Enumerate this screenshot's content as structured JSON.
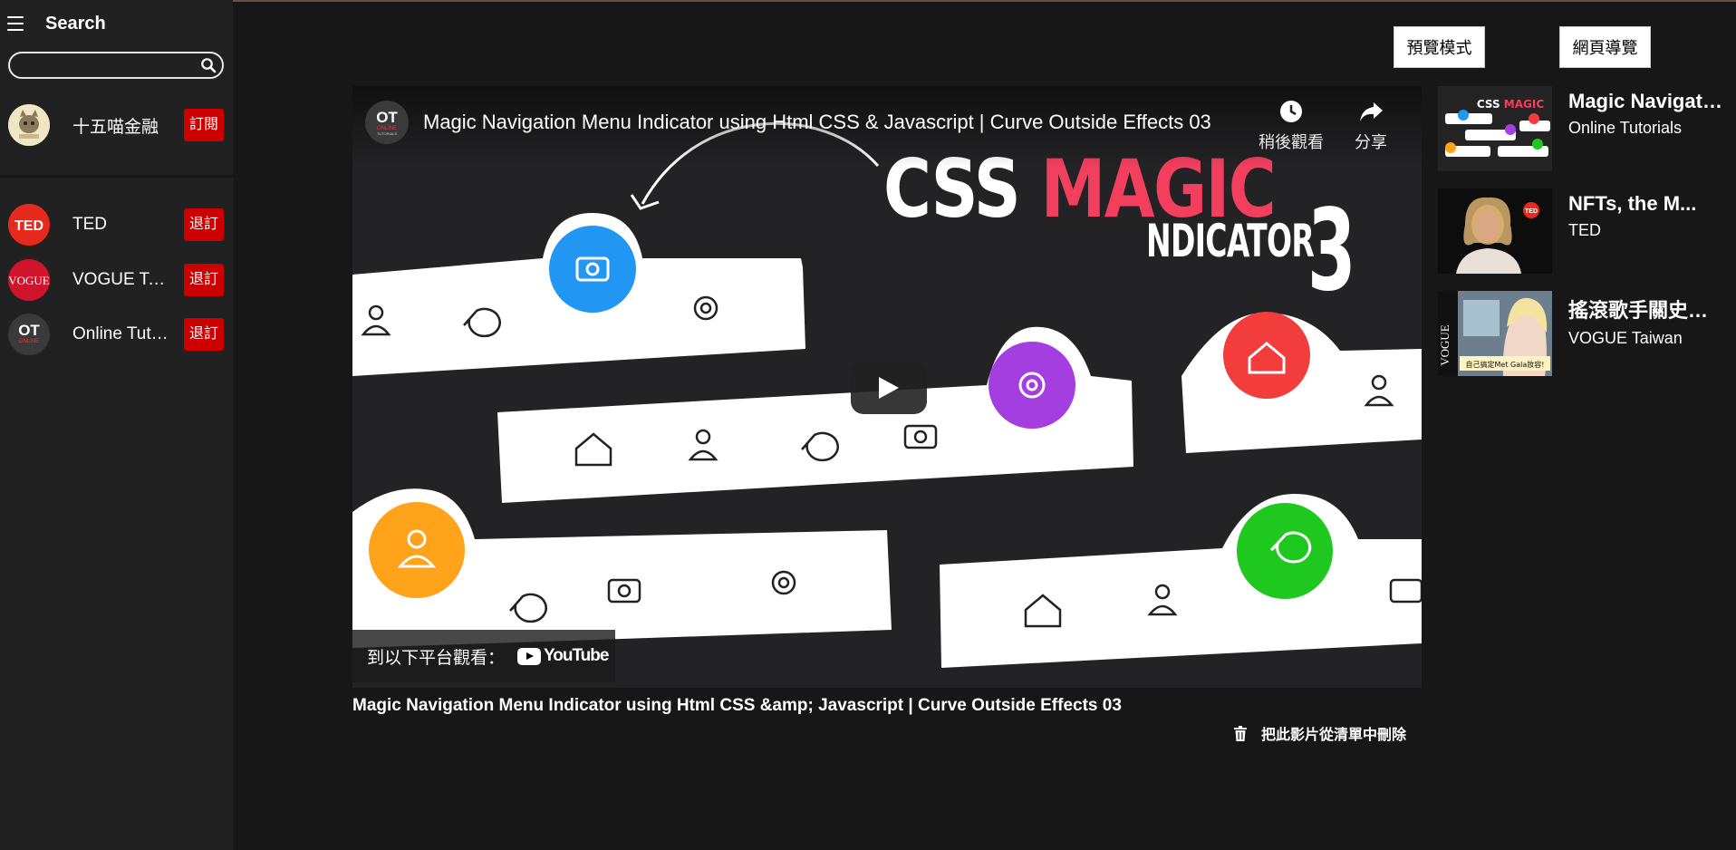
{
  "sidebar": {
    "title": "Search",
    "search": {
      "value": "",
      "placeholder": ""
    },
    "channels": [
      {
        "name": "十五喵金融",
        "button": "訂閱"
      },
      {
        "name": "TED",
        "button": "退訂"
      },
      {
        "name": "VOGUE Taiwan",
        "button": "退訂"
      },
      {
        "name": "Online Tutorials",
        "button": "退訂"
      }
    ]
  },
  "top_buttons": {
    "preview": "預覽模式",
    "navigation": "網頁導覽"
  },
  "player": {
    "title": "Magic Navigation Menu Indicator using Html CSS & Javascript | Curve Outside Effects 03",
    "channel_logo": {
      "line1": "OT",
      "line2": "ONLINE",
      "line3": "TUTORIALS"
    },
    "watch_later": "稍後觀看",
    "share": "分享",
    "thumb_text": {
      "css": "CSS",
      "magic": "MAGIC",
      "indicator": "NDICATOR",
      "number": "3"
    },
    "watch_on": "到以下平台觀看：",
    "youtube": "YouTube"
  },
  "caption": "Magic Navigation Menu Indicator using Html CSS &amp; Javascript | Curve Outside Effects 03",
  "remove_label": "把此影片從清單中刪除",
  "related": [
    {
      "title": "Magic Navigation Menu Indicator",
      "channel": "Online Tutorials"
    },
    {
      "title": "NFTs, the M...",
      "channel": "TED"
    },
    {
      "title": "搖滾歌手關史蒂芬妮",
      "channel": "VOGUE Taiwan",
      "thumb_text": "自己搞定Met Gala妝容!"
    }
  ],
  "colors": {
    "accent_red": "#cc0000",
    "magic_pink": "#f23f5e",
    "background": "#171717",
    "sidebar": "#212121"
  }
}
